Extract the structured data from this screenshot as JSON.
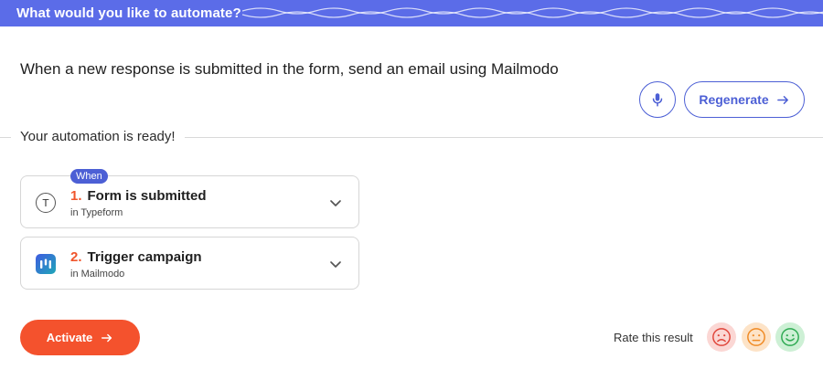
{
  "header": {
    "title": "What would you like to automate?",
    "accent_color": "#5b6ce8"
  },
  "prompt": {
    "text": "When a new response is submitted in the form, send an email using Mailmodo"
  },
  "actions": {
    "mic_icon": "microphone-icon",
    "regenerate_label": "Regenerate"
  },
  "result": {
    "ready_label": "Your automation is ready!"
  },
  "steps": [
    {
      "badge": "When",
      "number": "1.",
      "title": "Form is submitted",
      "app": "in Typeform",
      "icon": "typeform-icon",
      "icon_letter": "T"
    },
    {
      "badge": "",
      "number": "2.",
      "title": "Trigger campaign",
      "app": "in Mailmodo",
      "icon": "mailmodo-icon"
    }
  ],
  "footer": {
    "activate_label": "Activate",
    "activate_color": "#f4522d",
    "rate_label": "Rate this result",
    "ratings": [
      "sad-face-icon",
      "neutral-face-icon",
      "happy-face-icon"
    ]
  }
}
